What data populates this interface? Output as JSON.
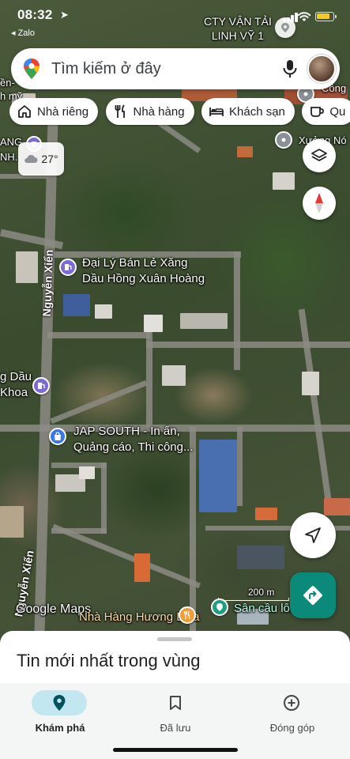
{
  "status_bar": {
    "time": "08:32",
    "back_label": "◂ Zalo",
    "battery_color": "#f7c826"
  },
  "search": {
    "placeholder": "Tìm kiếm ở đây",
    "icons": [
      "maps-pin-icon",
      "microphone-icon",
      "avatar"
    ]
  },
  "chips": [
    {
      "label": "Nhà riêng",
      "icon": "home-icon"
    },
    {
      "label": "Nhà hàng",
      "icon": "fork-knife-icon"
    },
    {
      "label": "Khách sạn",
      "icon": "bed-icon"
    },
    {
      "label": "Qu",
      "icon": "coffee-cup-icon"
    }
  ],
  "weather": {
    "temperature": "27°",
    "icon": "cloud-icon"
  },
  "map": {
    "labels": {
      "company": "CTY VẬN TẢI\nLINH VỸ 1",
      "cong": "Công",
      "xuong": "Xưởng Nó",
      "gas_station": "Đại Lý Bán Lẻ Xăng\nDầu Hồng Xuân Hoàng",
      "dau_khoa": "g Dầu\nKhoa",
      "jap_south": "JAP SOUTH - In ấn,\nQuảng cáo, Thi công...",
      "restaurant": "Nhà Hàng Hương Dừa",
      "san": "Sân cầu lông Tú",
      "left_top_1": "ền-",
      "left_top_2": "h mỹ",
      "left_mid_1": "ANG",
      "left_mid_2": "NH.",
      "street_upper": "Nguyễn Xiển",
      "street_lower": "Nguyễn Xiển",
      "attribution": "Google Maps",
      "scale": "200 m"
    },
    "accent": "#0b8a7a",
    "poi_purple": "#7e6ad6",
    "poi_orange": "#f29c38",
    "poi_teal": "#1e9e7f",
    "poi_gray": "#8a9196"
  },
  "sheet": {
    "title": "Tin mới nhất trong vùng"
  },
  "nav": [
    {
      "label": "Khám phá",
      "icon": "location-pin-icon",
      "active": true
    },
    {
      "label": "Đã lưu",
      "icon": "bookmark-icon",
      "active": false
    },
    {
      "label": "Đóng góp",
      "icon": "plus-circle-icon",
      "active": false
    }
  ]
}
